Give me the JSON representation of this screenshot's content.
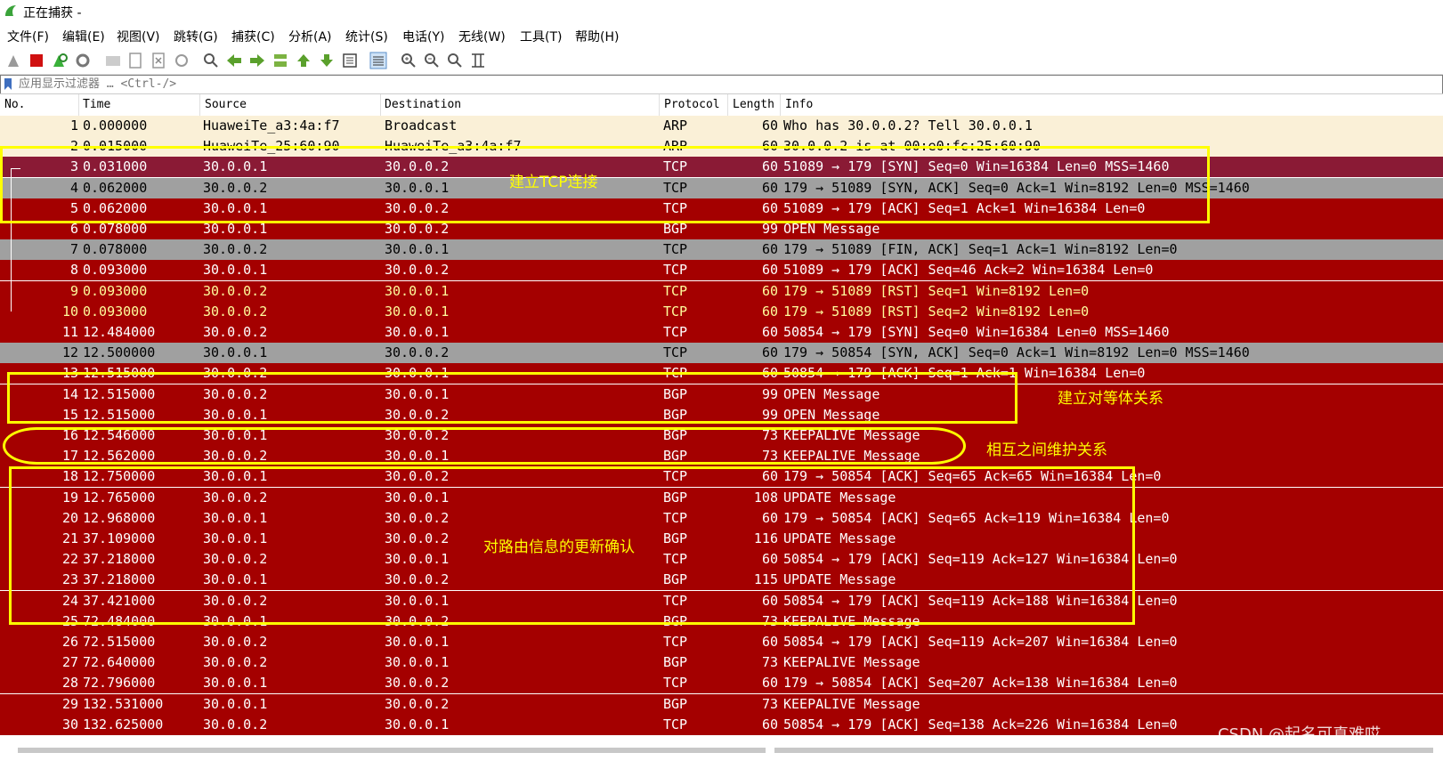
{
  "window": {
    "title": "正在捕获 -"
  },
  "menu": [
    "文件(F)",
    "编辑(E)",
    "视图(V)",
    "跳转(G)",
    "捕获(C)",
    "分析(A)",
    "统计(S)",
    "电话(Y)",
    "无线(W)",
    "工具(T)",
    "帮助(H)"
  ],
  "toolbar_icons": [
    "shark-fin-icon",
    "stop-icon",
    "restart-icon",
    "options-gear-icon",
    "open-folder-icon",
    "save-file-icon",
    "close-file-icon",
    "reload-icon",
    "find-icon",
    "go-back-icon",
    "go-forward-icon",
    "go-to-packet-icon",
    "first-packet-icon",
    "last-packet-icon",
    "autoscroll-icon",
    "colorize-icon",
    "zoom-in-icon",
    "zoom-out-icon",
    "normal-size-icon",
    "resize-columns-icon"
  ],
  "filter": {
    "placeholder": "应用显示过滤器 … <Ctrl-/>"
  },
  "columns": [
    "No.",
    "Time",
    "Source",
    "Destination",
    "Protocol",
    "Length",
    "Info"
  ],
  "colors": {
    "row_red": "#a40000",
    "row_darkred": "#8a1a35",
    "row_gray": "#a0a0a0",
    "row_light": "#faf0d7",
    "text_yellow": "#fffc9c",
    "annotation": "#ffff00"
  },
  "packets": [
    {
      "no": "1",
      "time": "0.000000",
      "src": "HuaweiTe_a3:4a:f7",
      "dst": "Broadcast",
      "proto": "ARP",
      "len": "60",
      "info": "Who has 30.0.0.2? Tell 30.0.0.1",
      "style": "light"
    },
    {
      "no": "2",
      "time": "0.015000",
      "src": "HuaweiTe_25:60:90",
      "dst": "HuaweiTe_a3:4a:f7",
      "proto": "ARP",
      "len": "60",
      "info": "30.0.0.2 is at 00:e0:fc:25:60:90",
      "style": "light"
    },
    {
      "no": "3",
      "time": "0.031000",
      "src": "30.0.0.1",
      "dst": "30.0.0.2",
      "proto": "TCP",
      "len": "60",
      "info": "51089 → 179 [SYN] Seq=0 Win=16384 Len=0 MSS=1460",
      "style": "darkred"
    },
    {
      "no": "4",
      "time": "0.062000",
      "src": "30.0.0.2",
      "dst": "30.0.0.1",
      "proto": "TCP",
      "len": "60",
      "info": "179 → 51089 [SYN, ACK] Seq=0 Ack=1 Win=8192 Len=0 MSS=1460",
      "style": "gray"
    },
    {
      "no": "5",
      "time": "0.062000",
      "src": "30.0.0.1",
      "dst": "30.0.0.2",
      "proto": "TCP",
      "len": "60",
      "info": "51089 → 179 [ACK] Seq=1 Ack=1 Win=16384 Len=0",
      "style": "red"
    },
    {
      "no": "6",
      "time": "0.078000",
      "src": "30.0.0.1",
      "dst": "30.0.0.2",
      "proto": "BGP",
      "len": "99",
      "info": "OPEN Message",
      "style": "red"
    },
    {
      "no": "7",
      "time": "0.078000",
      "src": "30.0.0.2",
      "dst": "30.0.0.1",
      "proto": "TCP",
      "len": "60",
      "info": "179 → 51089 [FIN, ACK] Seq=1 Ack=1 Win=8192 Len=0",
      "style": "gray"
    },
    {
      "no": "8",
      "time": "0.093000",
      "src": "30.0.0.1",
      "dst": "30.0.0.2",
      "proto": "TCP",
      "len": "60",
      "info": "51089 → 179 [ACK] Seq=46 Ack=2 Win=16384 Len=0",
      "style": "red"
    },
    {
      "no": "9",
      "time": "0.093000",
      "src": "30.0.0.2",
      "dst": "30.0.0.1",
      "proto": "TCP",
      "len": "60",
      "info": "179 → 51089 [RST] Seq=1 Win=8192 Len=0",
      "style": "redyellow"
    },
    {
      "no": "10",
      "time": "0.093000",
      "src": "30.0.0.2",
      "dst": "30.0.0.1",
      "proto": "TCP",
      "len": "60",
      "info": "179 → 51089 [RST] Seq=2 Win=8192 Len=0",
      "style": "redyellow"
    },
    {
      "no": "11",
      "time": "12.484000",
      "src": "30.0.0.2",
      "dst": "30.0.0.1",
      "proto": "TCP",
      "len": "60",
      "info": "50854 → 179 [SYN] Seq=0 Win=16384 Len=0 MSS=1460",
      "style": "red"
    },
    {
      "no": "12",
      "time": "12.500000",
      "src": "30.0.0.1",
      "dst": "30.0.0.2",
      "proto": "TCP",
      "len": "60",
      "info": "179 → 50854 [SYN, ACK] Seq=0 Ack=1 Win=8192 Len=0 MSS=1460",
      "style": "gray"
    },
    {
      "no": "13",
      "time": "12.515000",
      "src": "30.0.0.2",
      "dst": "30.0.0.1",
      "proto": "TCP",
      "len": "60",
      "info": "50854 → 179 [ACK] Seq=1 Ack=1 Win=16384 Len=0",
      "style": "red"
    },
    {
      "no": "14",
      "time": "12.515000",
      "src": "30.0.0.2",
      "dst": "30.0.0.1",
      "proto": "BGP",
      "len": "99",
      "info": "OPEN Message",
      "style": "red"
    },
    {
      "no": "15",
      "time": "12.515000",
      "src": "30.0.0.1",
      "dst": "30.0.0.2",
      "proto": "BGP",
      "len": "99",
      "info": "OPEN Message",
      "style": "red"
    },
    {
      "no": "16",
      "time": "12.546000",
      "src": "30.0.0.1",
      "dst": "30.0.0.2",
      "proto": "BGP",
      "len": "73",
      "info": "KEEPALIVE Message",
      "style": "red"
    },
    {
      "no": "17",
      "time": "12.562000",
      "src": "30.0.0.2",
      "dst": "30.0.0.1",
      "proto": "BGP",
      "len": "73",
      "info": "KEEPALIVE Message",
      "style": "red"
    },
    {
      "no": "18",
      "time": "12.750000",
      "src": "30.0.0.1",
      "dst": "30.0.0.2",
      "proto": "TCP",
      "len": "60",
      "info": "179 → 50854 [ACK] Seq=65 Ack=65 Win=16384 Len=0",
      "style": "red"
    },
    {
      "no": "19",
      "time": "12.765000",
      "src": "30.0.0.2",
      "dst": "30.0.0.1",
      "proto": "BGP",
      "len": "108",
      "info": "UPDATE Message",
      "style": "red"
    },
    {
      "no": "20",
      "time": "12.968000",
      "src": "30.0.0.1",
      "dst": "30.0.0.2",
      "proto": "TCP",
      "len": "60",
      "info": "179 → 50854 [ACK] Seq=65 Ack=119 Win=16384 Len=0",
      "style": "red"
    },
    {
      "no": "21",
      "time": "37.109000",
      "src": "30.0.0.1",
      "dst": "30.0.0.2",
      "proto": "BGP",
      "len": "116",
      "info": "UPDATE Message",
      "style": "red"
    },
    {
      "no": "22",
      "time": "37.218000",
      "src": "30.0.0.2",
      "dst": "30.0.0.1",
      "proto": "TCP",
      "len": "60",
      "info": "50854 → 179 [ACK] Seq=119 Ack=127 Win=16384 Len=0",
      "style": "red"
    },
    {
      "no": "23",
      "time": "37.218000",
      "src": "30.0.0.1",
      "dst": "30.0.0.2",
      "proto": "BGP",
      "len": "115",
      "info": "UPDATE Message",
      "style": "red"
    },
    {
      "no": "24",
      "time": "37.421000",
      "src": "30.0.0.2",
      "dst": "30.0.0.1",
      "proto": "TCP",
      "len": "60",
      "info": "50854 → 179 [ACK] Seq=119 Ack=188 Win=16384 Len=0",
      "style": "red"
    },
    {
      "no": "25",
      "time": "72.484000",
      "src": "30.0.0.1",
      "dst": "30.0.0.2",
      "proto": "BGP",
      "len": "73",
      "info": "KEEPALIVE Message",
      "style": "red"
    },
    {
      "no": "26",
      "time": "72.515000",
      "src": "30.0.0.2",
      "dst": "30.0.0.1",
      "proto": "TCP",
      "len": "60",
      "info": "50854 → 179 [ACK] Seq=119 Ack=207 Win=16384 Len=0",
      "style": "red"
    },
    {
      "no": "27",
      "time": "72.640000",
      "src": "30.0.0.2",
      "dst": "30.0.0.1",
      "proto": "BGP",
      "len": "73",
      "info": "KEEPALIVE Message",
      "style": "red"
    },
    {
      "no": "28",
      "time": "72.796000",
      "src": "30.0.0.1",
      "dst": "30.0.0.2",
      "proto": "TCP",
      "len": "60",
      "info": "179 → 50854 [ACK] Seq=207 Ack=138 Win=16384 Len=0",
      "style": "red"
    },
    {
      "no": "29",
      "time": "132.531000",
      "src": "30.0.0.1",
      "dst": "30.0.0.2",
      "proto": "BGP",
      "len": "73",
      "info": "KEEPALIVE Message",
      "style": "red"
    },
    {
      "no": "30",
      "time": "132.625000",
      "src": "30.0.0.2",
      "dst": "30.0.0.1",
      "proto": "TCP",
      "len": "60",
      "info": "50854 → 179 [ACK] Seq=138 Ack=226 Win=16384 Len=0",
      "style": "red"
    }
  ],
  "annotations": {
    "tcp_setup": "建立TCP连接",
    "peer_setup": "建立对等体关系",
    "maintain": "相互之间维护关系",
    "update_ack": "对路由信息的更新确认"
  },
  "watermark": "CSDN @起名可真难哎"
}
